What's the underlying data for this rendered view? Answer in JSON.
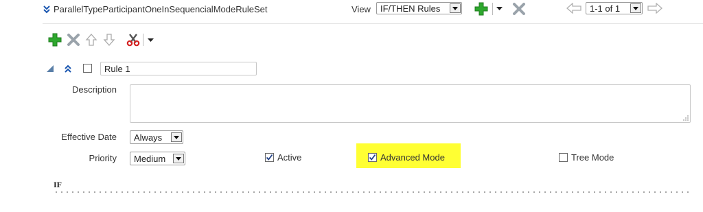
{
  "ruleset": {
    "title": "ParallelTypeParticipantOneInSequencialModeRuleSet"
  },
  "view": {
    "label": "View",
    "selected": "IF/THEN Rules"
  },
  "pager": {
    "selected": "1-1 of 1"
  },
  "rule": {
    "name": "Rule 1",
    "description_label": "Description",
    "description_value": "",
    "effective_date_label": "Effective Date",
    "effective_date_value": "Always",
    "priority_label": "Priority",
    "priority_value": "Medium",
    "active_label": "Active",
    "active_checked": true,
    "advanced_mode_label": "Advanced Mode",
    "advanced_mode_checked": true,
    "tree_mode_label": "Tree Mode",
    "tree_mode_checked": false,
    "if_label": "IF"
  },
  "colors": {
    "add_green": "#2ea82e",
    "highlight": "#ffff33",
    "link_blue": "#1a56b0"
  }
}
